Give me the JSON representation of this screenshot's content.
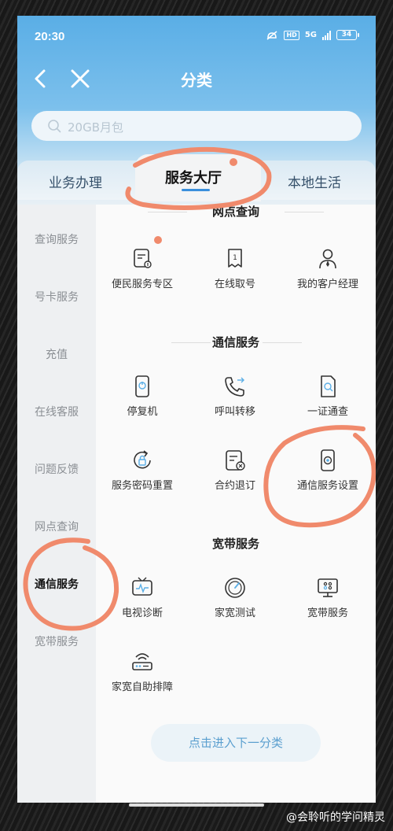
{
  "status_bar": {
    "time": "20:30",
    "network": "5G",
    "hd": "HD",
    "battery": "34"
  },
  "nav": {
    "title": "分类",
    "back_icon": "chevron-left-icon",
    "close_icon": "close-icon"
  },
  "search": {
    "placeholder": "20GB月包"
  },
  "tabs": [
    {
      "label": "业务办理",
      "active": false
    },
    {
      "label": "服务大厅",
      "active": true
    },
    {
      "label": "本地生活",
      "active": false
    }
  ],
  "sidebar": {
    "items": [
      {
        "label": "查询服务",
        "active": false
      },
      {
        "label": "号卡服务",
        "active": false
      },
      {
        "label": "充值",
        "active": false
      },
      {
        "label": "在线客服",
        "active": false
      },
      {
        "label": "问题反馈",
        "active": false
      },
      {
        "label": "网点查询",
        "active": false
      },
      {
        "label": "通信服务",
        "active": true
      },
      {
        "label": "宽带服务",
        "active": false
      }
    ]
  },
  "sections": [
    {
      "title": "网点查询",
      "items": [
        {
          "label": "便民服务专区",
          "icon": "service-card-icon"
        },
        {
          "label": "在线取号",
          "icon": "ticket-icon"
        },
        {
          "label": "我的客户经理",
          "icon": "manager-icon"
        }
      ]
    },
    {
      "title": "通信服务",
      "items": [
        {
          "label": "停复机",
          "icon": "phone-power-icon"
        },
        {
          "label": "呼叫转移",
          "icon": "call-forward-icon"
        },
        {
          "label": "一证通查",
          "icon": "id-search-icon"
        },
        {
          "label": "服务密码重置",
          "icon": "lock-reset-icon"
        },
        {
          "label": "合约退订",
          "icon": "contract-cancel-icon"
        },
        {
          "label": "通信服务设置",
          "icon": "phone-settings-icon"
        }
      ]
    },
    {
      "title": "宽带服务",
      "items": [
        {
          "label": "电视诊断",
          "icon": "tv-diagnose-icon"
        },
        {
          "label": "家宽测试",
          "icon": "speedtest-icon"
        },
        {
          "label": "宽带服务",
          "icon": "broadband-icon"
        },
        {
          "label": "家宽自助排障",
          "icon": "router-icon"
        }
      ]
    }
  ],
  "next_button": "点击进入下一分类",
  "watermark": "@会聆听的学问精灵",
  "colors": {
    "accent": "#3a8fdc",
    "header": "#5aaee6",
    "annotation": "#f08a6c"
  }
}
